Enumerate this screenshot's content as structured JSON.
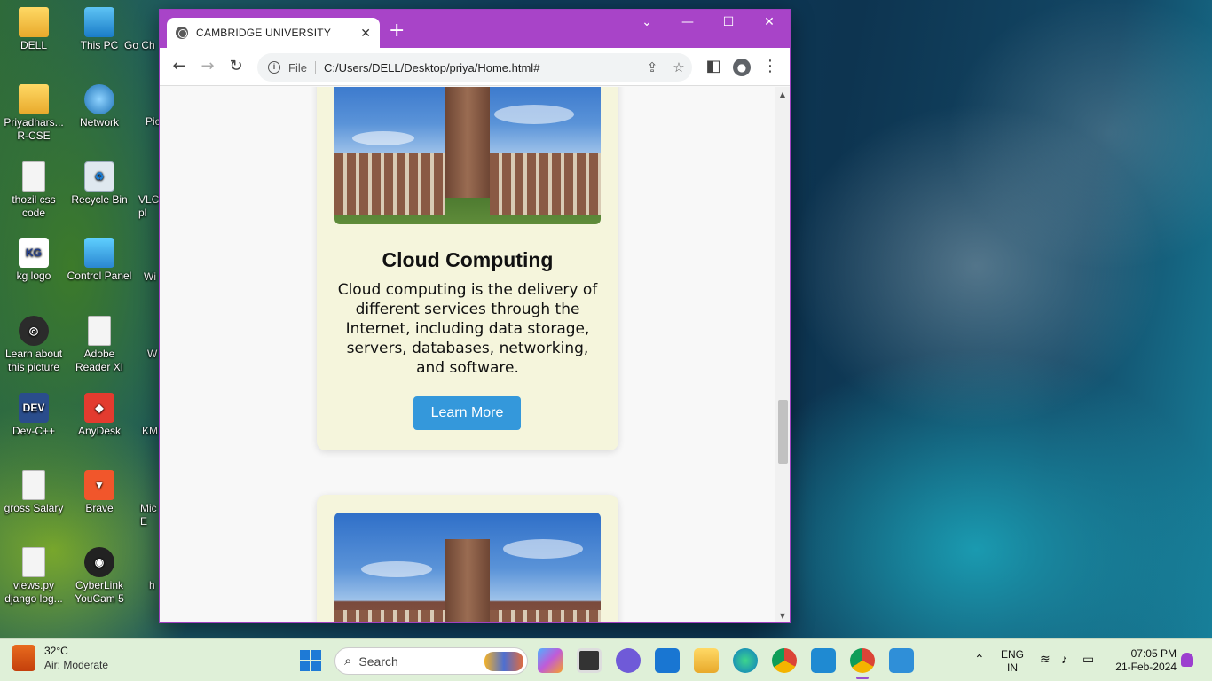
{
  "desktop": {
    "icons": [
      {
        "label": "DELL"
      },
      {
        "label": "This PC"
      },
      {
        "label": "Priyadhars... R-CSE"
      },
      {
        "label": "Network"
      },
      {
        "label": "thozil css code"
      },
      {
        "label": "Recycle Bin"
      },
      {
        "label": "kg logo"
      },
      {
        "label": "Control Panel"
      },
      {
        "label": "Learn about this picture"
      },
      {
        "label": "Adobe Reader XI"
      },
      {
        "label": "Dev-C++"
      },
      {
        "label": "AnyDesk"
      },
      {
        "label": "gross Salary"
      },
      {
        "label": "Brave"
      },
      {
        "label": "views.py django log..."
      },
      {
        "label": "CyberLink YouCam 5"
      }
    ],
    "partial_labels": [
      "Go Ch",
      "Pic",
      "VLC pl",
      "Wi",
      "W",
      "KM",
      "Mic E",
      "h"
    ]
  },
  "browser": {
    "tab_title": "CAMBRIDGE UNIVERSITY",
    "address": {
      "scheme": "File",
      "url": "C:/Users/DELL/Desktop/priya/Home.html#"
    },
    "accent_color": "#a844c8"
  },
  "page": {
    "cards": [
      {
        "title": "Cloud Computing",
        "description": "Cloud computing is the delivery of different services through the Internet, including data storage, servers, databases, networking, and software.",
        "button_label": "Learn More"
      }
    ],
    "card_bg": "#f5f5dc",
    "button_color": "#3498db"
  },
  "taskbar": {
    "weather": {
      "temp": "32°C",
      "condition": "Air: Moderate"
    },
    "search_placeholder": "Search",
    "language": {
      "line1": "ENG",
      "line2": "IN"
    },
    "time": "07:05 PM",
    "date": "21-Feb-2024"
  }
}
